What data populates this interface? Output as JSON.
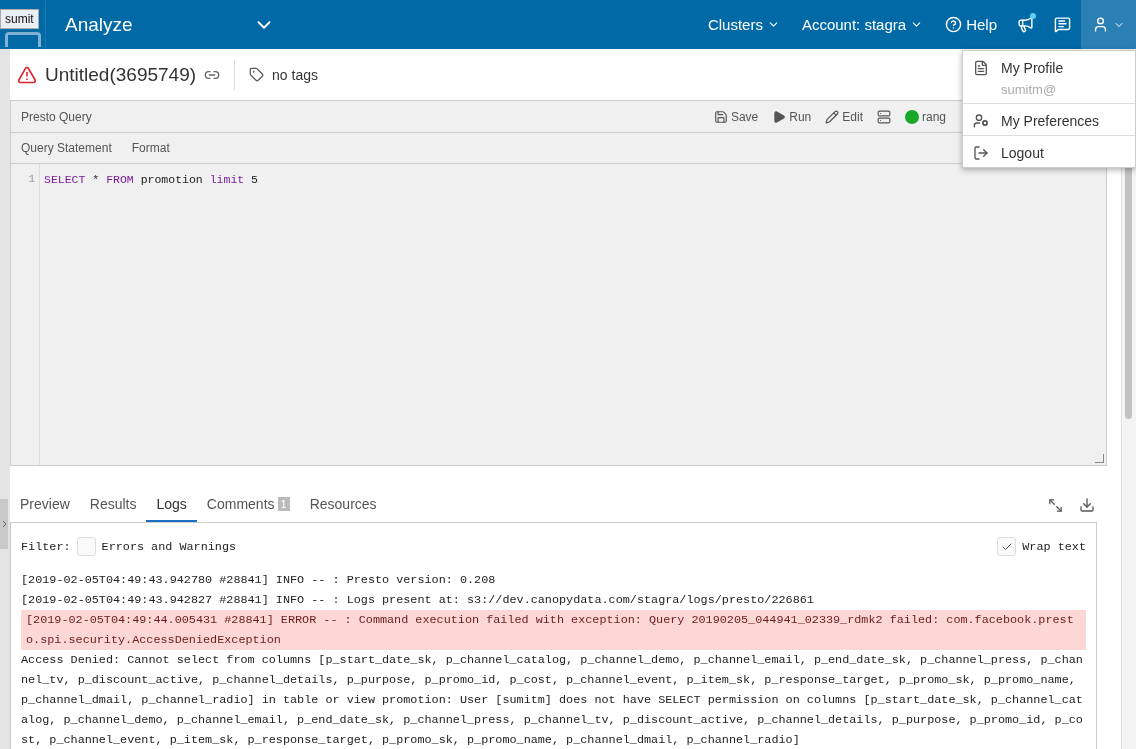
{
  "tooltip": "sumit",
  "topbar": {
    "title": "Analyze",
    "menus": [
      {
        "label": "Clusters"
      },
      {
        "label": "Account: stagra"
      }
    ],
    "help": "Help",
    "announcement_unread": true
  },
  "user_menu": {
    "open": true,
    "items": [
      {
        "kind": "profile",
        "label": "My Profile",
        "email": "sumitm@"
      },
      {
        "kind": "preferences",
        "label": "My Preferences"
      },
      {
        "kind": "logout",
        "label": "Logout"
      }
    ]
  },
  "query": {
    "title": "Untitled(3695749)",
    "error": true,
    "tags": "no tags"
  },
  "editor": {
    "type": "Presto Query",
    "actions": [
      {
        "kind": "save",
        "label": "Save"
      },
      {
        "kind": "run",
        "label": "Run"
      },
      {
        "kind": "edit",
        "label": "Edit"
      }
    ],
    "cluster": {
      "label": "rang",
      "up": true
    },
    "subtabs": [
      "Query Statement",
      "Format"
    ],
    "lines": [
      {
        "number": "1",
        "tokens": [
          {
            "kind": "keyword",
            "text": "SELECT"
          },
          {
            "kind": "plain",
            "text": " * "
          },
          {
            "kind": "keyword",
            "text": "FROM"
          },
          {
            "kind": "plain",
            "text": " promotion "
          },
          {
            "kind": "keyword",
            "text": "limit"
          },
          {
            "kind": "plain",
            "text": " 5"
          }
        ]
      }
    ]
  },
  "results": {
    "tabs": [
      {
        "label": "Preview",
        "selected": false
      },
      {
        "label": "Results",
        "selected": false
      },
      {
        "label": "Logs",
        "selected": true
      },
      {
        "label": "Comments",
        "selected": false,
        "badge": "1"
      },
      {
        "label": "Resources",
        "selected": false
      }
    ],
    "filter_label": "Filter:",
    "errors_only": {
      "label": "Errors and Warnings",
      "checked": false
    },
    "wrap": {
      "label": "Wrap text",
      "checked": true
    },
    "log": [
      {
        "kind": "info",
        "text": "[2019-02-05T04:49:43.942780 #28841] INFO -- : Presto version: 0.208"
      },
      {
        "kind": "info",
        "text": "[2019-02-05T04:49:43.942827 #28841] INFO -- : Logs present at: s3://dev.canopydata.com/stagra/logs/presto/226861"
      },
      {
        "kind": "error",
        "text": "[2019-02-05T04:49:44.005431 #28841] ERROR -- : Command execution failed with exception: Query 20190205_044941_02339_rdmk2 failed: com.facebook.presto.spi.security.AccessDeniedException"
      },
      {
        "kind": "info",
        "text": "Access Denied: Cannot select from columns [p_start_date_sk, p_channel_catalog, p_channel_demo, p_channel_email, p_end_date_sk, p_channel_press, p_channel_tv, p_discount_active, p_channel_details, p_purpose, p_promo_id, p_cost, p_channel_event, p_item_sk, p_response_target, p_promo_sk, p_promo_name, p_channel_dmail, p_channel_radio] in table or view promotion: User [sumitm] does not have SELECT permission on columns [p_start_date_sk, p_channel_catalog, p_channel_demo, p_channel_email, p_end_date_sk, p_channel_press, p_channel_tv, p_discount_active, p_channel_details, p_purpose, p_promo_id, p_cost, p_channel_event, p_item_sk, p_response_target, p_promo_sk, p_promo_name, p_channel_dmail, p_channel_radio]"
      }
    ]
  }
}
